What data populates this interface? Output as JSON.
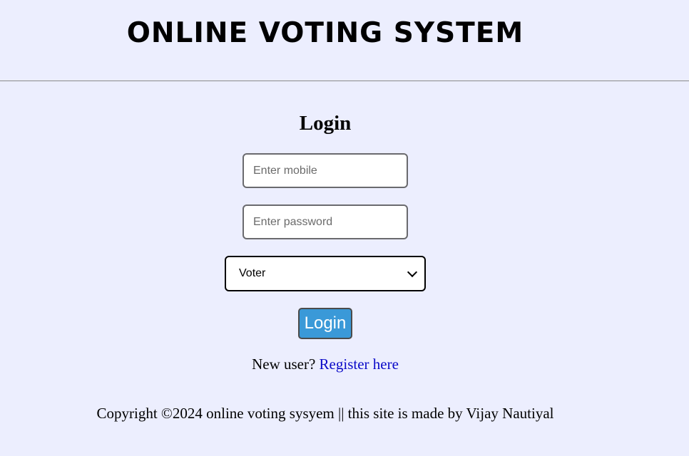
{
  "header": {
    "site_title": "ONLINE VOTING SYSTEM"
  },
  "login_form": {
    "heading": "Login",
    "mobile_placeholder": "Enter mobile",
    "mobile_value": "",
    "password_placeholder": "Enter password",
    "password_value": "",
    "role_selected": "Voter",
    "submit_label": "Login"
  },
  "register": {
    "prompt": "New user?",
    "link_label": "Register here"
  },
  "footer": {
    "copyright": "Copyright ©2024 online voting sysyem || this site is made by Vijay Nautiyal"
  },
  "colors": {
    "page_background": "#eceefe",
    "button_background": "#3a99d8",
    "link": "#0a0ac8"
  }
}
